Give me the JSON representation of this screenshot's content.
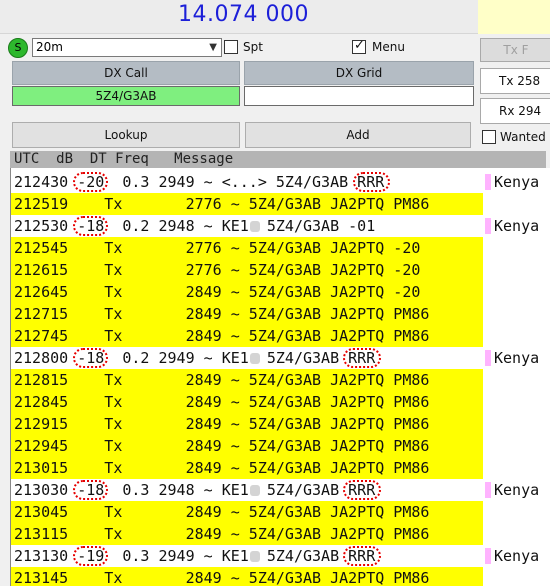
{
  "frequency": "14.074 000",
  "band": {
    "led_label": "S",
    "selected": "20m",
    "spt_label": "Spt",
    "spt_checked": false,
    "menu_label": "Menu",
    "menu_checked": true
  },
  "txf_button": "Tx F",
  "dx_call": {
    "label": "DX Call",
    "value": "5Z4/G3AB"
  },
  "dx_grid": {
    "label": "DX Grid",
    "value": ""
  },
  "tx_freq": "Tx 258",
  "rx_freq": "Rx 294",
  "lookup_label": "Lookup",
  "add_label": "Add",
  "wanted_label": "Wanted",
  "table_header": "UTC  dB  DT Freq   Message",
  "rows": [
    {
      "utc": "212430",
      "db": "-20",
      "dt": "0.3",
      "freq": "2949",
      "msg": "~ <...> 5Z4/G3AB RRR",
      "country": "Kenya",
      "tx": false
    },
    {
      "utc": "212519",
      "db": "Tx",
      "dt": "",
      "freq": "2776",
      "msg": "~ 5Z4/G3AB JA2PTQ PM86",
      "country": "",
      "tx": true
    },
    {
      "utc": "212530",
      "db": "-18",
      "dt": "0.2",
      "freq": "2948",
      "msg": "~ KE1  5Z4/G3AB -01",
      "country": "Kenya",
      "tx": false
    },
    {
      "utc": "212545",
      "db": "Tx",
      "dt": "",
      "freq": "2776",
      "msg": "~ 5Z4/G3AB JA2PTQ -20",
      "country": "",
      "tx": true
    },
    {
      "utc": "212615",
      "db": "Tx",
      "dt": "",
      "freq": "2776",
      "msg": "~ 5Z4/G3AB JA2PTQ -20",
      "country": "",
      "tx": true
    },
    {
      "utc": "212645",
      "db": "Tx",
      "dt": "",
      "freq": "2849",
      "msg": "~ 5Z4/G3AB JA2PTQ -20",
      "country": "",
      "tx": true
    },
    {
      "utc": "212715",
      "db": "Tx",
      "dt": "",
      "freq": "2849",
      "msg": "~ 5Z4/G3AB JA2PTQ PM86",
      "country": "",
      "tx": true
    },
    {
      "utc": "212745",
      "db": "Tx",
      "dt": "",
      "freq": "2849",
      "msg": "~ 5Z4/G3AB JA2PTQ PM86",
      "country": "",
      "tx": true
    },
    {
      "utc": "212800",
      "db": "-18",
      "dt": "0.2",
      "freq": "2949",
      "msg": "~ KE1  5Z4/G3AB RRR",
      "country": "Kenya",
      "tx": false
    },
    {
      "utc": "212815",
      "db": "Tx",
      "dt": "",
      "freq": "2849",
      "msg": "~ 5Z4/G3AB JA2PTQ PM86",
      "country": "",
      "tx": true
    },
    {
      "utc": "212845",
      "db": "Tx",
      "dt": "",
      "freq": "2849",
      "msg": "~ 5Z4/G3AB JA2PTQ PM86",
      "country": "",
      "tx": true
    },
    {
      "utc": "212915",
      "db": "Tx",
      "dt": "",
      "freq": "2849",
      "msg": "~ 5Z4/G3AB JA2PTQ PM86",
      "country": "",
      "tx": true
    },
    {
      "utc": "212945",
      "db": "Tx",
      "dt": "",
      "freq": "2849",
      "msg": "~ 5Z4/G3AB JA2PTQ PM86",
      "country": "",
      "tx": true
    },
    {
      "utc": "213015",
      "db": "Tx",
      "dt": "",
      "freq": "2849",
      "msg": "~ 5Z4/G3AB JA2PTQ PM86",
      "country": "",
      "tx": true
    },
    {
      "utc": "213030",
      "db": "-18",
      "dt": "0.3",
      "freq": "2948",
      "msg": "~ KE1  5Z4/G3AB RRR",
      "country": "Kenya",
      "tx": false
    },
    {
      "utc": "213045",
      "db": "Tx",
      "dt": "",
      "freq": "2849",
      "msg": "~ 5Z4/G3AB JA2PTQ PM86",
      "country": "",
      "tx": true
    },
    {
      "utc": "213115",
      "db": "Tx",
      "dt": "",
      "freq": "2849",
      "msg": "~ 5Z4/G3AB JA2PTQ PM86",
      "country": "",
      "tx": true
    },
    {
      "utc": "213130",
      "db": "-19",
      "dt": "0.3",
      "freq": "2949",
      "msg": "~ KE1  5Z4/G3AB RRR",
      "country": "Kenya",
      "tx": false
    },
    {
      "utc": "213145",
      "db": "Tx",
      "dt": "",
      "freq": "2849",
      "msg": "~ 5Z4/G3AB JA2PTQ PM86",
      "country": "",
      "tx": true
    }
  ],
  "colors": {
    "tx_highlight": "#ffff00",
    "dx_call_bg": "#7fef7f",
    "frequency_text": "#1c1fd8",
    "annotation": "#e60000",
    "country_marker": "#ffb3ff"
  }
}
